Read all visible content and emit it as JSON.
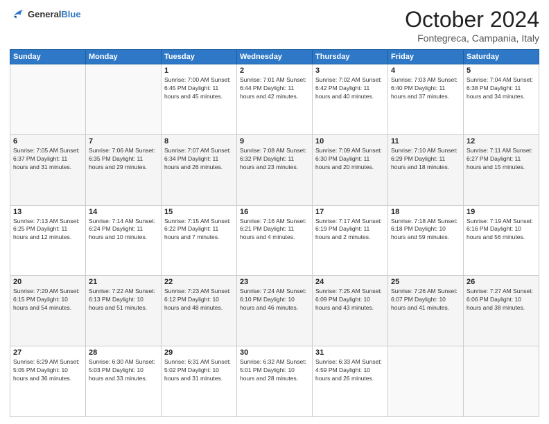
{
  "header": {
    "logo_general": "General",
    "logo_blue": "Blue",
    "month_title": "October 2024",
    "location": "Fontegreca, Campania, Italy"
  },
  "days_of_week": [
    "Sunday",
    "Monday",
    "Tuesday",
    "Wednesday",
    "Thursday",
    "Friday",
    "Saturday"
  ],
  "weeks": [
    [
      {
        "day": "",
        "info": ""
      },
      {
        "day": "",
        "info": ""
      },
      {
        "day": "1",
        "info": "Sunrise: 7:00 AM\nSunset: 6:45 PM\nDaylight: 11 hours and 45 minutes."
      },
      {
        "day": "2",
        "info": "Sunrise: 7:01 AM\nSunset: 6:44 PM\nDaylight: 11 hours and 42 minutes."
      },
      {
        "day": "3",
        "info": "Sunrise: 7:02 AM\nSunset: 6:42 PM\nDaylight: 11 hours and 40 minutes."
      },
      {
        "day": "4",
        "info": "Sunrise: 7:03 AM\nSunset: 6:40 PM\nDaylight: 11 hours and 37 minutes."
      },
      {
        "day": "5",
        "info": "Sunrise: 7:04 AM\nSunset: 6:38 PM\nDaylight: 11 hours and 34 minutes."
      }
    ],
    [
      {
        "day": "6",
        "info": "Sunrise: 7:05 AM\nSunset: 6:37 PM\nDaylight: 11 hours and 31 minutes."
      },
      {
        "day": "7",
        "info": "Sunrise: 7:06 AM\nSunset: 6:35 PM\nDaylight: 11 hours and 29 minutes."
      },
      {
        "day": "8",
        "info": "Sunrise: 7:07 AM\nSunset: 6:34 PM\nDaylight: 11 hours and 26 minutes."
      },
      {
        "day": "9",
        "info": "Sunrise: 7:08 AM\nSunset: 6:32 PM\nDaylight: 11 hours and 23 minutes."
      },
      {
        "day": "10",
        "info": "Sunrise: 7:09 AM\nSunset: 6:30 PM\nDaylight: 11 hours and 20 minutes."
      },
      {
        "day": "11",
        "info": "Sunrise: 7:10 AM\nSunset: 6:29 PM\nDaylight: 11 hours and 18 minutes."
      },
      {
        "day": "12",
        "info": "Sunrise: 7:11 AM\nSunset: 6:27 PM\nDaylight: 11 hours and 15 minutes."
      }
    ],
    [
      {
        "day": "13",
        "info": "Sunrise: 7:13 AM\nSunset: 6:25 PM\nDaylight: 11 hours and 12 minutes."
      },
      {
        "day": "14",
        "info": "Sunrise: 7:14 AM\nSunset: 6:24 PM\nDaylight: 11 hours and 10 minutes."
      },
      {
        "day": "15",
        "info": "Sunrise: 7:15 AM\nSunset: 6:22 PM\nDaylight: 11 hours and 7 minutes."
      },
      {
        "day": "16",
        "info": "Sunrise: 7:16 AM\nSunset: 6:21 PM\nDaylight: 11 hours and 4 minutes."
      },
      {
        "day": "17",
        "info": "Sunrise: 7:17 AM\nSunset: 6:19 PM\nDaylight: 11 hours and 2 minutes."
      },
      {
        "day": "18",
        "info": "Sunrise: 7:18 AM\nSunset: 6:18 PM\nDaylight: 10 hours and 59 minutes."
      },
      {
        "day": "19",
        "info": "Sunrise: 7:19 AM\nSunset: 6:16 PM\nDaylight: 10 hours and 56 minutes."
      }
    ],
    [
      {
        "day": "20",
        "info": "Sunrise: 7:20 AM\nSunset: 6:15 PM\nDaylight: 10 hours and 54 minutes."
      },
      {
        "day": "21",
        "info": "Sunrise: 7:22 AM\nSunset: 6:13 PM\nDaylight: 10 hours and 51 minutes."
      },
      {
        "day": "22",
        "info": "Sunrise: 7:23 AM\nSunset: 6:12 PM\nDaylight: 10 hours and 48 minutes."
      },
      {
        "day": "23",
        "info": "Sunrise: 7:24 AM\nSunset: 6:10 PM\nDaylight: 10 hours and 46 minutes."
      },
      {
        "day": "24",
        "info": "Sunrise: 7:25 AM\nSunset: 6:09 PM\nDaylight: 10 hours and 43 minutes."
      },
      {
        "day": "25",
        "info": "Sunrise: 7:26 AM\nSunset: 6:07 PM\nDaylight: 10 hours and 41 minutes."
      },
      {
        "day": "26",
        "info": "Sunrise: 7:27 AM\nSunset: 6:06 PM\nDaylight: 10 hours and 38 minutes."
      }
    ],
    [
      {
        "day": "27",
        "info": "Sunrise: 6:29 AM\nSunset: 5:05 PM\nDaylight: 10 hours and 36 minutes."
      },
      {
        "day": "28",
        "info": "Sunrise: 6:30 AM\nSunset: 5:03 PM\nDaylight: 10 hours and 33 minutes."
      },
      {
        "day": "29",
        "info": "Sunrise: 6:31 AM\nSunset: 5:02 PM\nDaylight: 10 hours and 31 minutes."
      },
      {
        "day": "30",
        "info": "Sunrise: 6:32 AM\nSunset: 5:01 PM\nDaylight: 10 hours and 28 minutes."
      },
      {
        "day": "31",
        "info": "Sunrise: 6:33 AM\nSunset: 4:59 PM\nDaylight: 10 hours and 26 minutes."
      },
      {
        "day": "",
        "info": ""
      },
      {
        "day": "",
        "info": ""
      }
    ]
  ]
}
